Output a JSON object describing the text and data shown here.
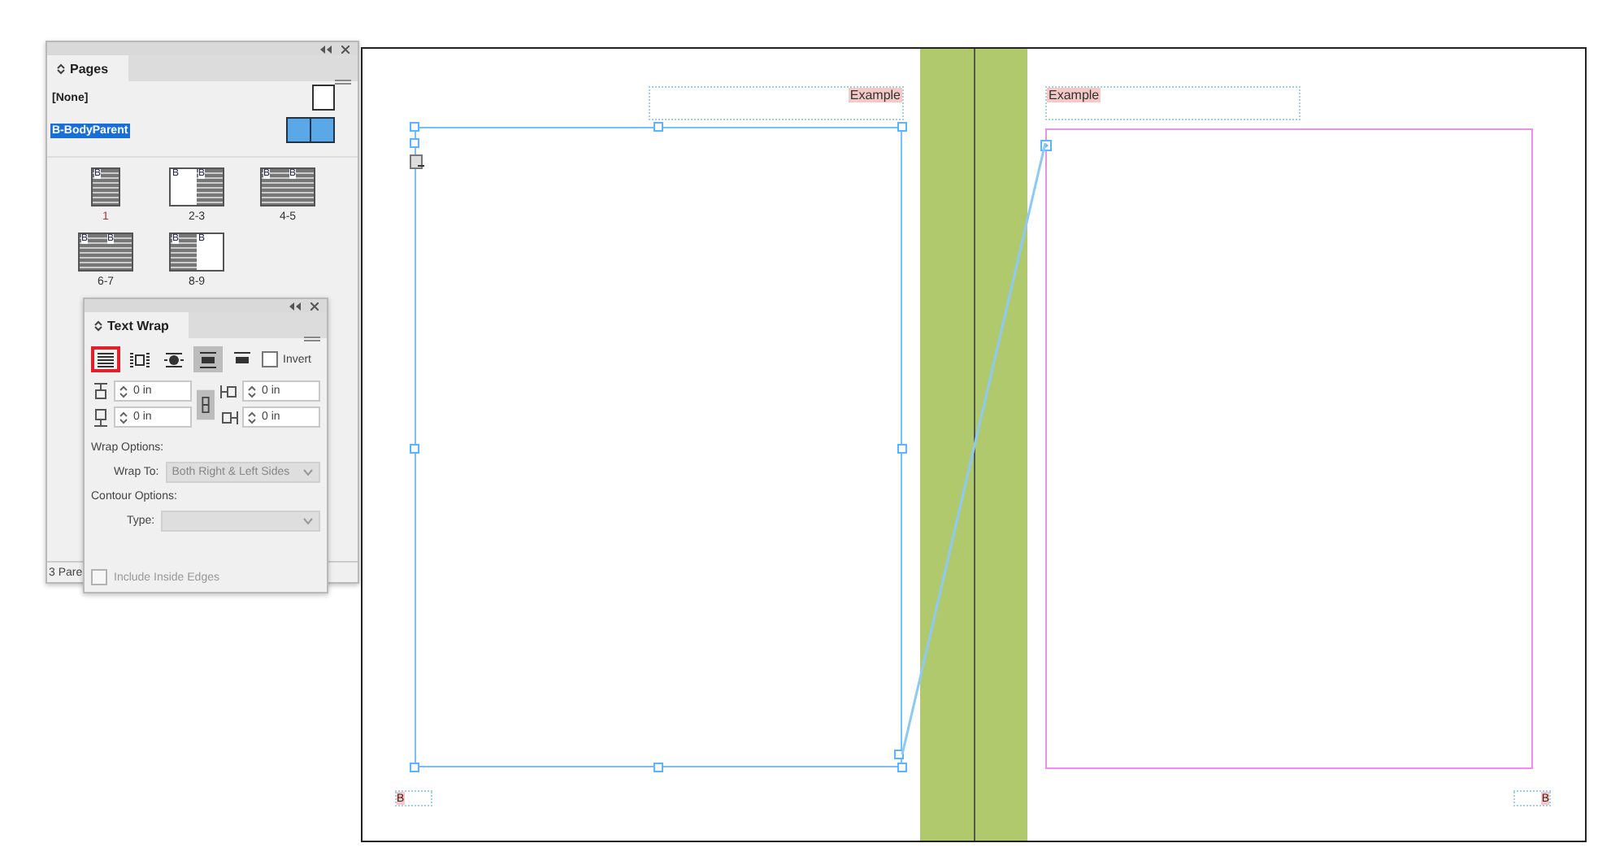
{
  "pages_panel": {
    "tab": "Pages",
    "parents": [
      {
        "label": "[None]",
        "selected": false,
        "kind": "single"
      },
      {
        "label": "B-BodyParent",
        "selected": true,
        "kind": "spread"
      }
    ],
    "spreads": [
      {
        "label": "1",
        "current": true,
        "pages": [
          {
            "kind": "text",
            "prefix": "B"
          }
        ]
      },
      {
        "label": "2-3",
        "current": false,
        "pages": [
          {
            "kind": "blank",
            "prefix": "B"
          },
          {
            "kind": "text",
            "prefix": "B"
          }
        ]
      },
      {
        "label": "4-5",
        "current": false,
        "pages": [
          {
            "kind": "text",
            "prefix": "B"
          },
          {
            "kind": "text",
            "prefix": "B"
          }
        ]
      },
      {
        "label": "6-7",
        "current": false,
        "pages": [
          {
            "kind": "text",
            "prefix": "B"
          },
          {
            "kind": "text",
            "prefix": "B"
          }
        ]
      },
      {
        "label": "8-9",
        "current": false,
        "pages": [
          {
            "kind": "text",
            "prefix": "B"
          },
          {
            "kind": "blank",
            "prefix": "B"
          }
        ]
      }
    ],
    "footer": "3 Pare"
  },
  "text_wrap_panel": {
    "tab": "Text Wrap",
    "wrap_modes": [
      {
        "kind": "none",
        "selected": false,
        "highlighted": true
      },
      {
        "kind": "bounding",
        "selected": false,
        "highlighted": false
      },
      {
        "kind": "shape",
        "selected": false,
        "highlighted": false
      },
      {
        "kind": "jump",
        "selected": true,
        "highlighted": false
      },
      {
        "kind": "next",
        "selected": false,
        "highlighted": false
      }
    ],
    "invert": {
      "label": "Invert",
      "checked": false
    },
    "offsets": [
      {
        "kind": "top",
        "value": "0 in"
      },
      {
        "kind": "left",
        "value": "0 in"
      },
      {
        "kind": "bottom",
        "value": "0 in"
      },
      {
        "kind": "right",
        "value": "0 in"
      }
    ],
    "wrap_options_heading": "Wrap Options:",
    "wrap_to": {
      "label": "Wrap To:",
      "value": "Both Right & Left Sides",
      "disabled": true
    },
    "contour_heading": "Contour Options:",
    "type": {
      "label": "Type:",
      "disabled": true
    },
    "include_inside_edges": {
      "label": "Include Inside Edges",
      "checked": false,
      "disabled": true
    }
  },
  "spread": {
    "header_left": "Example",
    "header_right": "Example",
    "folio_left": "B",
    "folio_right": "B"
  }
}
